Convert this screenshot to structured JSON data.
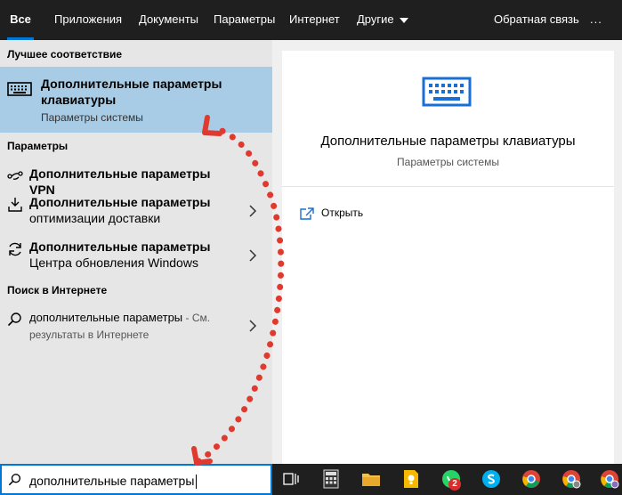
{
  "tabs": [
    {
      "label": "Все",
      "active": true
    },
    {
      "label": "Приложения"
    },
    {
      "label": "Документы"
    },
    {
      "label": "Параметры"
    },
    {
      "label": "Интернет"
    },
    {
      "label": "Другие"
    }
  ],
  "topbar": {
    "feedback": "Обратная связь",
    "more": "..."
  },
  "sections": {
    "best": "Лучшее соответствие",
    "settings": "Параметры",
    "web": "Поиск в Интернете"
  },
  "best_match": {
    "title": "Дополнительные параметры клавиатуры",
    "subtitle": "Параметры системы",
    "icon": "keyboard-icon"
  },
  "settings_items": [
    {
      "label": "Дополнительные параметры VPN",
      "icon": "vpn-icon"
    },
    {
      "label_line1": "Дополнительные параметры",
      "label_line2": "оптимизации доставки",
      "icon": "delivery-optimization-icon"
    },
    {
      "label_line1": "Дополнительные параметры",
      "label_line2": "Центра обновления Windows",
      "icon": "windows-update-icon"
    }
  ],
  "web_result": {
    "query": "дополнительные параметры",
    "suffix": " - См.",
    "line2": "результаты в Интернете",
    "icon": "search-icon"
  },
  "preview": {
    "title": "Дополнительные параметры клавиатуры",
    "subtitle": "Параметры системы",
    "open_label": "Открыть"
  },
  "search": {
    "value": "дополнительные параметры"
  },
  "taskbar": {
    "badge_count": "2",
    "icons": [
      "task-view-icon",
      "calculator-icon",
      "file-explorer-icon",
      "keep-icon",
      "whatsapp-icon",
      "skype-icon",
      "chrome-icon",
      "chrome-profile-icon",
      "chrome-profile-icon-2"
    ]
  },
  "colors": {
    "accent": "#0078d7",
    "highlight": "#a8cce6",
    "annotation": "#e03a2f"
  }
}
